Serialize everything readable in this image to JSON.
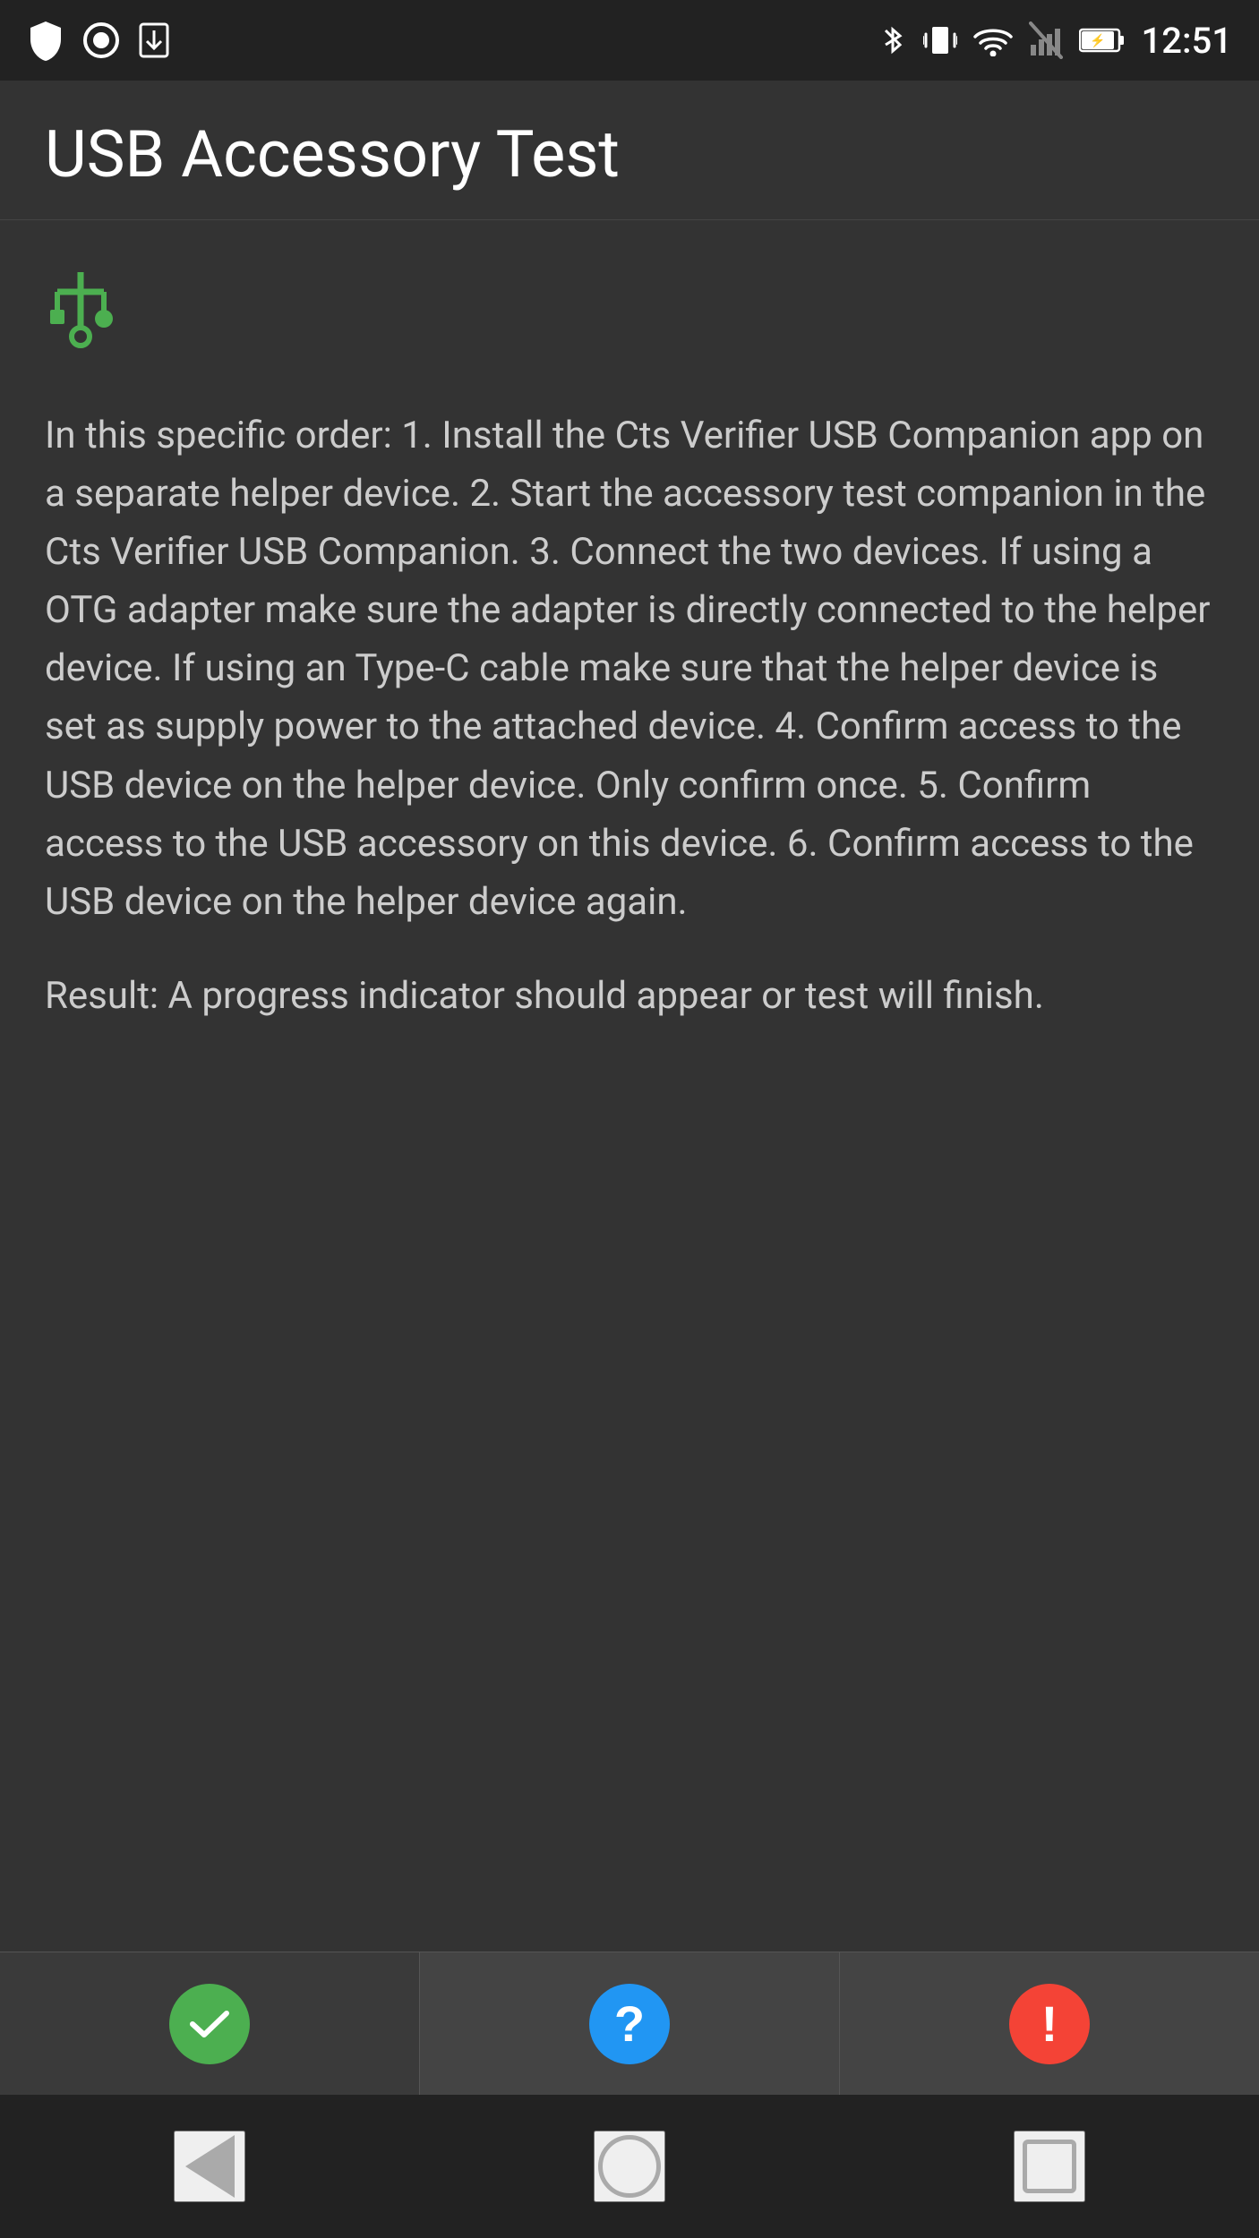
{
  "statusBar": {
    "time": "12:51",
    "leftIcons": [
      "shield",
      "record",
      "download"
    ],
    "rightIcons": [
      "bluetooth",
      "vibrate",
      "wifi",
      "signal-off",
      "battery"
    ],
    "colors": {
      "background": "#222222",
      "text": "#ffffff"
    }
  },
  "appBar": {
    "title": "USB Accessory Test",
    "backgroundColor": "#333333"
  },
  "main": {
    "usbIconColor": "#4caf50",
    "instructions": "In this specific order:\n1. Install the Cts Verifier USB Companion app on a separate helper device.\n2. Start the accessory test companion in the Cts Verifier USB Companion.\n3. Connect the two devices. If using a OTG adapter make sure the adapter is directly connected to the helper device. If using an Type-C cable make sure that the helper device is set as supply power to the attached device.\n4. Confirm access to the USB device on the helper device. Only confirm once.\n5. Confirm access to the USB accessory on this device.\n6. Confirm access to the USB device on the helper device again.",
    "result": "Result: A progress indicator should appear or test will finish."
  },
  "bottomBar": {
    "passButton": {
      "label": "Pass",
      "iconColor": "#4caf50"
    },
    "infoButton": {
      "label": "Info",
      "iconColor": "#2196f3"
    },
    "failButton": {
      "label": "Fail",
      "iconColor": "#f44336"
    }
  },
  "navBar": {
    "backLabel": "Back",
    "homeLabel": "Home",
    "recentsLabel": "Recents"
  }
}
